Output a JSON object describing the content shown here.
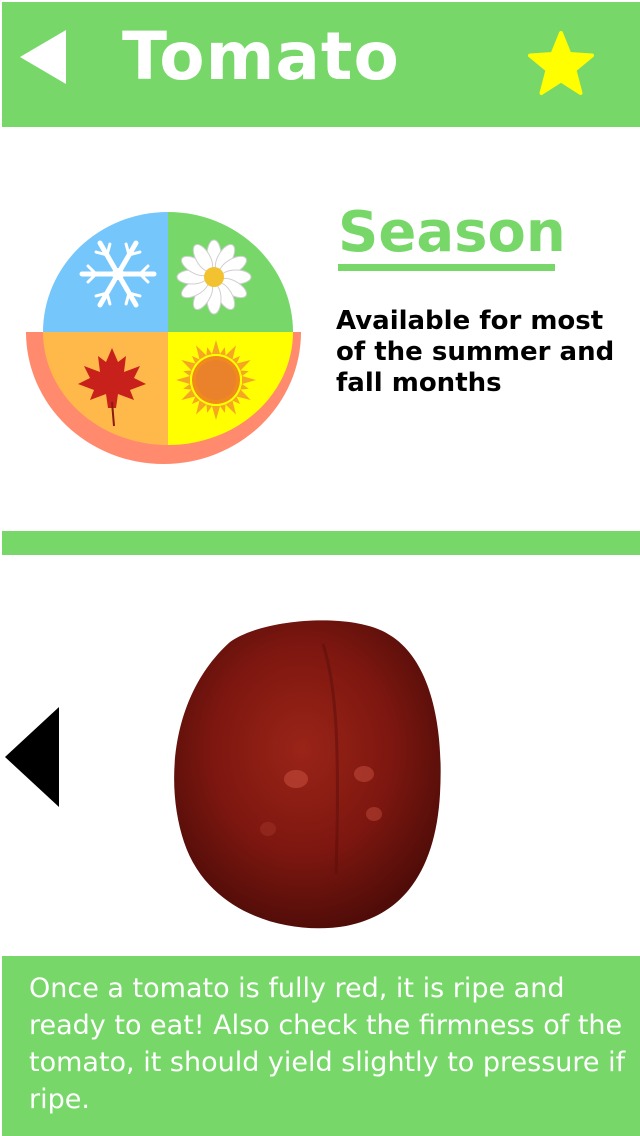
{
  "header": {
    "title": "Tomato",
    "back_icon": "back-arrow-icon",
    "favorite_icon": "star-icon",
    "favorite_color": "#ffff00"
  },
  "season": {
    "heading": "Season",
    "description": "Available for most of the summer and fall months",
    "wheel_icons": [
      "winter-snowflake-icon",
      "spring-daisy-icon",
      "fall-maple-leaf-icon",
      "summer-sun-icon"
    ],
    "highlighted_seasons": [
      "summer",
      "fall"
    ],
    "colors": {
      "winter": "#74c6fb",
      "spring": "#77d869",
      "fall": "#ffb94a",
      "summer": "#ffff00",
      "highlight_ring": "#ff8a6e"
    }
  },
  "carousel": {
    "prev_icon": "previous-arrow-icon",
    "image": "tomato-image"
  },
  "tip": {
    "text": "Once a tomato is fully red, it is ripe and ready to eat! Also check the firmness of the tomato, it should yield slightly to pressure if ripe."
  },
  "theme": {
    "accent": "#77d869",
    "background": "#ffffff"
  }
}
